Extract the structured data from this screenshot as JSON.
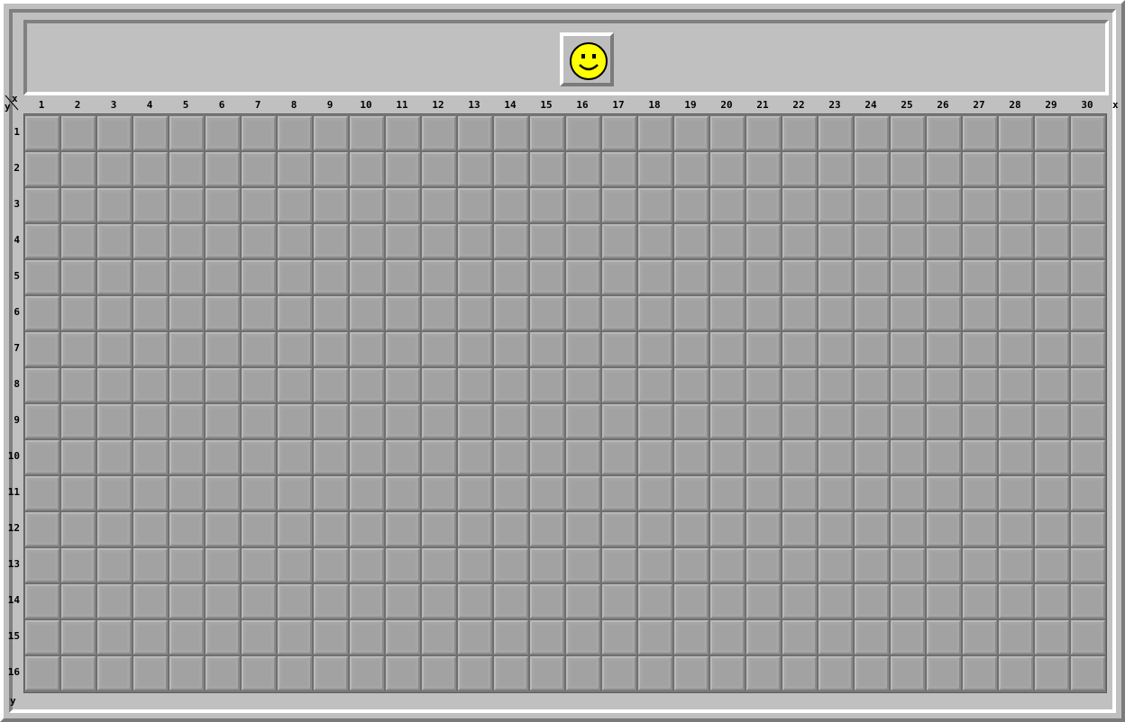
{
  "game": {
    "face_state": "smile",
    "face_icon": "smiley-face-icon",
    "columns": [
      "1",
      "2",
      "3",
      "4",
      "5",
      "6",
      "7",
      "8",
      "9",
      "10",
      "11",
      "12",
      "13",
      "14",
      "15",
      "16",
      "17",
      "18",
      "19",
      "20",
      "21",
      "22",
      "23",
      "24",
      "25",
      "26",
      "27",
      "28",
      "29",
      "30"
    ],
    "rows": [
      "1",
      "2",
      "3",
      "4",
      "5",
      "6",
      "7",
      "8",
      "9",
      "10",
      "11",
      "12",
      "13",
      "14",
      "15",
      "16"
    ],
    "axis": {
      "x_label": "x",
      "y_label": "y",
      "corner_x": "x",
      "corner_y": "y"
    },
    "cell_state": "unrevealed"
  },
  "colors": {
    "face_yellow": "#ffff00",
    "panel": "#c0c0c0",
    "cell": "#a6a6a6"
  }
}
